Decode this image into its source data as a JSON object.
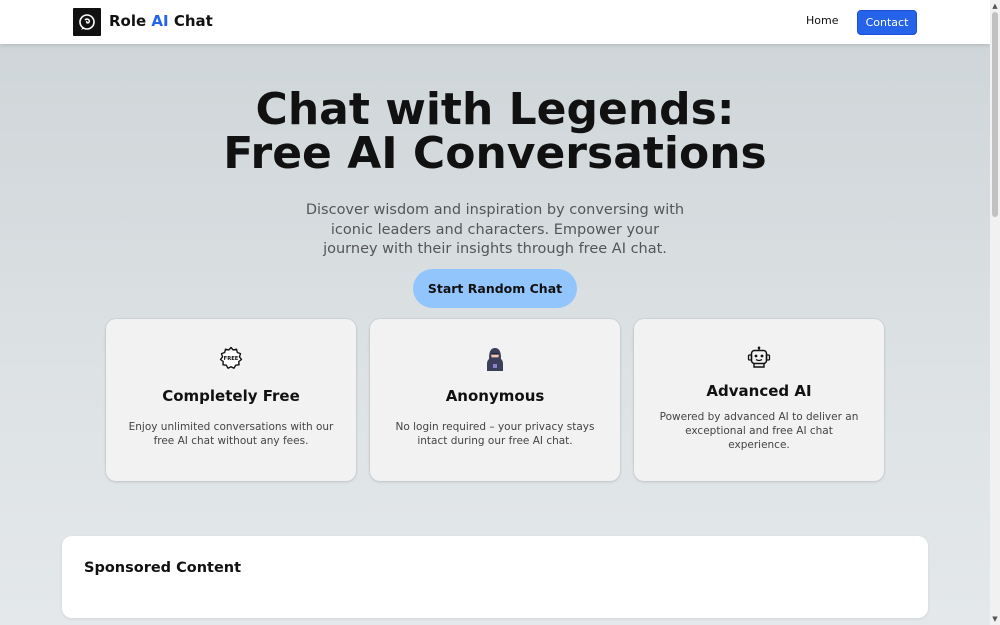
{
  "header": {
    "brand_prefix": "Role",
    "brand_accent": "AI",
    "brand_suffix": "Chat",
    "logo_icon": "brain-chat-icon",
    "nav": {
      "home": "Home",
      "contact": "Contact"
    }
  },
  "hero": {
    "title_line1": "Chat with Legends:",
    "title_line2": "Free AI Conversations",
    "subtitle": "Discover wisdom and inspiration by conversing with iconic leaders and characters. Empower your journey with their insights through free AI chat.",
    "cta_label": "Start Random Chat"
  },
  "features": [
    {
      "icon": "free-badge-icon",
      "title": "Completely Free",
      "description": "Enjoy unlimited conversations with our free AI chat without any fees."
    },
    {
      "icon": "hooded-user-icon",
      "title": "Anonymous",
      "description": "No login required – your privacy stays intact during our free AI chat."
    },
    {
      "icon": "robot-icon",
      "title": "Advanced AI",
      "description": "Powered by advanced AI to deliver an exceptional and free AI chat experience."
    }
  ],
  "sponsored": {
    "title": "Sponsored Content"
  },
  "colors": {
    "accent": "#2563eb",
    "cta_background": "#93c5fd",
    "page_background": "#d4dadc"
  }
}
